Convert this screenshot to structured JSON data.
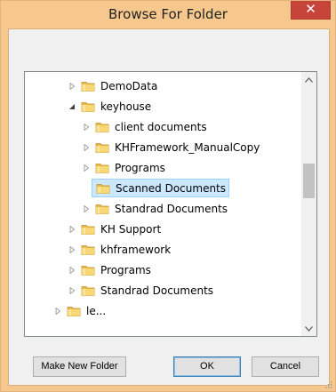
{
  "window": {
    "title": "Browse For Folder",
    "close_glyph": "✕"
  },
  "tree": {
    "items": [
      {
        "label": "DemoData",
        "level": 1,
        "expander": "collapsed",
        "selected": false
      },
      {
        "label": "keyhouse",
        "level": 1,
        "expander": "expanded",
        "selected": false
      },
      {
        "label": "client documents",
        "level": 2,
        "expander": "collapsed",
        "selected": false
      },
      {
        "label": "KHFramework_ManualCopy",
        "level": 2,
        "expander": "collapsed",
        "selected": false
      },
      {
        "label": "Programs",
        "level": 2,
        "expander": "collapsed",
        "selected": false
      },
      {
        "label": "Scanned Documents",
        "level": 2,
        "expander": "none",
        "selected": true
      },
      {
        "label": "Standrad Documents",
        "level": 2,
        "expander": "collapsed",
        "selected": false
      },
      {
        "label": "KH Support",
        "level": 1,
        "expander": "collapsed",
        "selected": false
      },
      {
        "label": "khframework",
        "level": 1,
        "expander": "collapsed",
        "selected": false
      },
      {
        "label": "Programs",
        "level": 1,
        "expander": "collapsed",
        "selected": false
      },
      {
        "label": "Standrad Documents",
        "level": 1,
        "expander": "collapsed",
        "selected": false
      },
      {
        "label": "le...",
        "level": 0,
        "expander": "collapsed",
        "selected": false
      }
    ]
  },
  "buttons": {
    "make_new_folder": "Make New Folder",
    "ok": "OK",
    "cancel": "Cancel"
  },
  "colors": {
    "accent_selection": "#cce8ff",
    "title_bar": "#f7c88e",
    "close_button": "#c7443b"
  }
}
